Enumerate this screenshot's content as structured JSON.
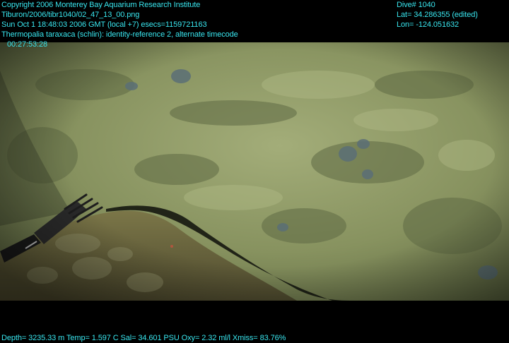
{
  "overlay": {
    "copyright": "Copyright 2006 Monterey Bay Aquarium Research Institute",
    "file_path": "Tiburon/2006/tibr1040/02_47_13_00.png",
    "datetime": "Sun Oct  1 18:48:03 2006 GMT (local +7)  esecs=1159721163",
    "annotation": "Thermopalia taraxaca (schlin): identity-reference 2, alternate timecode",
    "timecode": "00:27:53:28",
    "dive": "Dive# 1040",
    "lat": "Lat= 34.286355 (edited)",
    "lon": "Lon= -124.051632",
    "sensors": "Depth= 3235.33 m  Temp= 1.597 C  Sal= 34.601 PSU  Oxy= 2.32 ml/l  Xmiss= 83.76%"
  },
  "colors": {
    "overlay_text": "#39e6ef",
    "seafloor": "#7d8a58",
    "sediment": "#6e6640",
    "background": "#000000"
  }
}
